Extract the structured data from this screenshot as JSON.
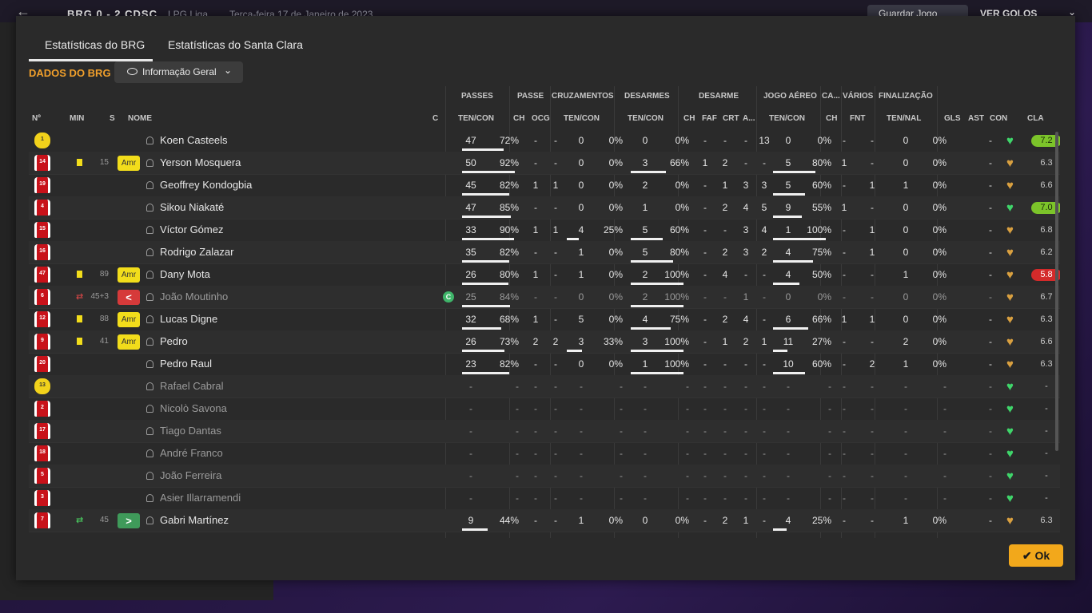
{
  "topbar": {
    "score": "BRG 0 - 2 CDSC",
    "league": "LPG Liga",
    "date": "Terça-feira 17 de Janeiro de 2023",
    "save_label": "Guardar Jogo",
    "goals_label": "VER GOLOS"
  },
  "tabs": [
    "Estatísticas do BRG",
    "Estatísticas do Santa Clara"
  ],
  "section_title": "DADOS DO BRG",
  "view_select": "Informação Geral",
  "ok_label": "Ok",
  "groups": {
    "passes": "PASSES",
    "passe": "PASSE",
    "cruz": "CRUZAMENTOS",
    "desarmes": "DESARMES",
    "desarme": "DESARME",
    "aereo": "JOGO AÉREO",
    "ca": "CA...",
    "varios": "VÁRIOS",
    "final": "FINALIZAÇÃO"
  },
  "columns": {
    "num": "Nº",
    "min": "MIN",
    "s": "S",
    "nome": "NOME",
    "c": "C",
    "pass_tc": "TEN/CON",
    "pch": "CH",
    "pocg": "OCG",
    "cruz_tc": "TEN/CON",
    "des_tc": "TEN/CON",
    "dch": "CH",
    "dfaf": "FAF",
    "dcrt": "CRT",
    "da": "A...",
    "aer_tc": "TEN/CON",
    "cach": "CH",
    "vfnt": "FNT",
    "fin_tn": "TEN/NAL",
    "gls": "GLS",
    "ast": "AST",
    "con": "CON",
    "cla": "CLA"
  },
  "players": [
    {
      "num": "1",
      "kit": "yellow",
      "min": "",
      "card": false,
      "sub": "",
      "role": "",
      "name": "Koen Casteels",
      "c": false,
      "pt": "47",
      "pp": "72%",
      "pch": "-",
      "pocg": "-",
      "ct": "0",
      "cp": "0%",
      "dt": "0",
      "dp": "0%",
      "dch": "-",
      "dfaf": "-",
      "dcrt": "-",
      "da": "13",
      "at": "0",
      "ap": "0%",
      "cach": "-",
      "vfnt": "-",
      "ft": "0",
      "fp": "0%",
      "gls": "",
      "ast": "-",
      "rating": "7.2",
      "rstyle": "green",
      "pbar": 0.72,
      "cbar": 0,
      "dbar": 0,
      "abar": 0
    },
    {
      "num": "14",
      "kit": "red",
      "min": "15",
      "card": true,
      "sub": "",
      "role": "Amr",
      "name": "Yerson Mosquera",
      "c": false,
      "pt": "50",
      "pp": "92%",
      "pch": "-",
      "pocg": "-",
      "ct": "0",
      "cp": "0%",
      "dt": "3",
      "dp": "66%",
      "dch": "1",
      "dfaf": "2",
      "dcrt": "-",
      "da": "-",
      "at": "5",
      "ap": "80%",
      "cach": "1",
      "vfnt": "-",
      "ft": "0",
      "fp": "0%",
      "gls": "",
      "ast": "-",
      "rating": "6.3",
      "rstyle": "plain",
      "pbar": 0.92,
      "cbar": 0,
      "dbar": 0.66,
      "abar": 0.8
    },
    {
      "num": "19",
      "kit": "red",
      "min": "",
      "card": false,
      "sub": "",
      "role": "",
      "name": "Geoffrey Kondogbia",
      "c": false,
      "pt": "45",
      "pp": "82%",
      "pch": "1",
      "pocg": "1",
      "ct": "0",
      "cp": "0%",
      "dt": "2",
      "dp": "0%",
      "dch": "-",
      "dfaf": "1",
      "dcrt": "3",
      "da": "3",
      "at": "5",
      "ap": "60%",
      "cach": "-",
      "vfnt": "1",
      "ft": "1",
      "fp": "0%",
      "gls": "",
      "ast": "-",
      "rating": "6.6",
      "rstyle": "plain",
      "pbar": 0.82,
      "cbar": 0,
      "dbar": 0,
      "abar": 0.6
    },
    {
      "num": "4",
      "kit": "red",
      "min": "",
      "card": false,
      "sub": "",
      "role": "",
      "name": "Sikou Niakaté",
      "c": false,
      "pt": "47",
      "pp": "85%",
      "pch": "-",
      "pocg": "-",
      "ct": "0",
      "cp": "0%",
      "dt": "1",
      "dp": "0%",
      "dch": "-",
      "dfaf": "2",
      "dcrt": "4",
      "da": "5",
      "at": "9",
      "ap": "55%",
      "cach": "1",
      "vfnt": "-",
      "ft": "0",
      "fp": "0%",
      "gls": "",
      "ast": "-",
      "rating": "7.0",
      "rstyle": "green",
      "pbar": 0.85,
      "cbar": 0,
      "dbar": 0,
      "abar": 0.55
    },
    {
      "num": "15",
      "kit": "red",
      "min": "",
      "card": false,
      "sub": "",
      "role": "",
      "name": "Víctor Gómez",
      "c": false,
      "pt": "33",
      "pp": "90%",
      "pch": "1",
      "pocg": "1",
      "ct": "4",
      "cp": "25%",
      "dt": "5",
      "dp": "60%",
      "dch": "-",
      "dfaf": "-",
      "dcrt": "3",
      "da": "4",
      "at": "1",
      "ap": "100%",
      "cach": "-",
      "vfnt": "1",
      "ft": "0",
      "fp": "0%",
      "gls": "",
      "ast": "-",
      "rating": "6.8",
      "rstyle": "plain",
      "pbar": 0.9,
      "cbar": 0.25,
      "dbar": 0.6,
      "abar": 1.0
    },
    {
      "num": "16",
      "kit": "red",
      "min": "",
      "card": false,
      "sub": "",
      "role": "",
      "name": "Rodrigo Zalazar",
      "c": false,
      "pt": "35",
      "pp": "82%",
      "pch": "-",
      "pocg": "-",
      "ct": "1",
      "cp": "0%",
      "dt": "5",
      "dp": "80%",
      "dch": "-",
      "dfaf": "2",
      "dcrt": "3",
      "da": "2",
      "at": "4",
      "ap": "75%",
      "cach": "-",
      "vfnt": "1",
      "ft": "0",
      "fp": "0%",
      "gls": "",
      "ast": "-",
      "rating": "6.2",
      "rstyle": "plain",
      "pbar": 0.82,
      "cbar": 0,
      "dbar": 0.8,
      "abar": 0.75
    },
    {
      "num": "47",
      "kit": "red",
      "min": "89",
      "card": true,
      "sub": "",
      "role": "Amr",
      "name": "Dany Mota",
      "c": false,
      "pt": "26",
      "pp": "80%",
      "pch": "1",
      "pocg": "-",
      "ct": "1",
      "cp": "0%",
      "dt": "2",
      "dp": "100%",
      "dch": "-",
      "dfaf": "4",
      "dcrt": "-",
      "da": "-",
      "at": "4",
      "ap": "50%",
      "cach": "-",
      "vfnt": "-",
      "ft": "1",
      "fp": "0%",
      "gls": "",
      "ast": "-",
      "rating": "5.8",
      "rstyle": "red",
      "pbar": 0.8,
      "cbar": 0,
      "dbar": 1.0,
      "abar": 0.5
    },
    {
      "num": "6",
      "kit": "red",
      "min": "45+3",
      "card": false,
      "sub": "out",
      "role": "out",
      "name": "João Moutinho",
      "c": true,
      "pt": "25",
      "pp": "84%",
      "pch": "-",
      "pocg": "-",
      "ct": "0",
      "cp": "0%",
      "dt": "2",
      "dp": "100%",
      "dch": "-",
      "dfaf": "-",
      "dcrt": "1",
      "da": "-",
      "at": "0",
      "ap": "0%",
      "cach": "-",
      "vfnt": "-",
      "ft": "0",
      "fp": "0%",
      "gls": "",
      "ast": "-",
      "rating": "6.7",
      "rstyle": "plain",
      "pbar": 0.84,
      "cbar": 0,
      "dbar": 1.0,
      "abar": 0,
      "dim": true
    },
    {
      "num": "12",
      "kit": "red",
      "min": "88",
      "card": true,
      "sub": "",
      "role": "Amr",
      "name": "Lucas Digne",
      "c": false,
      "pt": "32",
      "pp": "68%",
      "pch": "1",
      "pocg": "-",
      "ct": "5",
      "cp": "0%",
      "dt": "4",
      "dp": "75%",
      "dch": "-",
      "dfaf": "2",
      "dcrt": "4",
      "da": "-",
      "at": "6",
      "ap": "66%",
      "cach": "1",
      "vfnt": "1",
      "ft": "0",
      "fp": "0%",
      "gls": "",
      "ast": "-",
      "rating": "6.3",
      "rstyle": "plain",
      "pbar": 0.68,
      "cbar": 0,
      "dbar": 0.75,
      "abar": 0.66
    },
    {
      "num": "9",
      "kit": "red",
      "min": "41",
      "card": true,
      "sub": "",
      "role": "Amr",
      "name": "Pedro",
      "c": false,
      "pt": "26",
      "pp": "73%",
      "pch": "2",
      "pocg": "2",
      "ct": "3",
      "cp": "33%",
      "dt": "3",
      "dp": "100%",
      "dch": "-",
      "dfaf": "1",
      "dcrt": "2",
      "da": "1",
      "at": "11",
      "ap": "27%",
      "cach": "-",
      "vfnt": "-",
      "ft": "2",
      "fp": "0%",
      "gls": "",
      "ast": "-",
      "rating": "6.6",
      "rstyle": "plain",
      "pbar": 0.73,
      "cbar": 0.33,
      "dbar": 1.0,
      "abar": 0.27
    },
    {
      "num": "20",
      "kit": "red",
      "min": "",
      "card": false,
      "sub": "",
      "role": "",
      "name": "Pedro Raul",
      "c": false,
      "pt": "23",
      "pp": "82%",
      "pch": "-",
      "pocg": "-",
      "ct": "0",
      "cp": "0%",
      "dt": "1",
      "dp": "100%",
      "dch": "-",
      "dfaf": "-",
      "dcrt": "-",
      "da": "-",
      "at": "10",
      "ap": "60%",
      "cach": "-",
      "vfnt": "2",
      "ft": "1",
      "fp": "0%",
      "gls": "",
      "ast": "-",
      "rating": "6.3",
      "rstyle": "plain",
      "pbar": 0.82,
      "cbar": 0,
      "dbar": 1.0,
      "abar": 0.6
    },
    {
      "num": "13",
      "kit": "yellow",
      "min": "",
      "card": false,
      "sub": "",
      "role": "",
      "name": "Rafael Cabral",
      "c": false,
      "pt": "-",
      "pp": "-",
      "pch": "-",
      "pocg": "-",
      "ct": "-",
      "cp": "-",
      "dt": "-",
      "dp": "-",
      "dch": "-",
      "dfaf": "-",
      "dcrt": "-",
      "da": "-",
      "at": "-",
      "ap": "-",
      "cach": "-",
      "vfnt": "-",
      "ft": "-",
      "fp": "-",
      "gls": "",
      "ast": "-",
      "rating": "-",
      "rstyle": "plain",
      "pbar": 0,
      "cbar": 0,
      "dbar": 0,
      "abar": 0,
      "dim": true
    },
    {
      "num": "2",
      "kit": "red",
      "min": "",
      "card": false,
      "sub": "",
      "role": "",
      "name": "Nicolò Savona",
      "c": false,
      "pt": "-",
      "pp": "-",
      "pch": "-",
      "pocg": "-",
      "ct": "-",
      "cp": "-",
      "dt": "-",
      "dp": "-",
      "dch": "-",
      "dfaf": "-",
      "dcrt": "-",
      "da": "-",
      "at": "-",
      "ap": "-",
      "cach": "-",
      "vfnt": "-",
      "ft": "-",
      "fp": "-",
      "gls": "",
      "ast": "-",
      "rating": "-",
      "rstyle": "plain",
      "pbar": 0,
      "cbar": 0,
      "dbar": 0,
      "abar": 0,
      "dim": true
    },
    {
      "num": "17",
      "kit": "red",
      "min": "",
      "card": false,
      "sub": "",
      "role": "",
      "name": "Tiago Dantas",
      "c": false,
      "pt": "-",
      "pp": "-",
      "pch": "-",
      "pocg": "-",
      "ct": "-",
      "cp": "-",
      "dt": "-",
      "dp": "-",
      "dch": "-",
      "dfaf": "-",
      "dcrt": "-",
      "da": "-",
      "at": "-",
      "ap": "-",
      "cach": "-",
      "vfnt": "-",
      "ft": "-",
      "fp": "-",
      "gls": "",
      "ast": "-",
      "rating": "-",
      "rstyle": "plain",
      "pbar": 0,
      "cbar": 0,
      "dbar": 0,
      "abar": 0,
      "dim": true
    },
    {
      "num": "18",
      "kit": "red",
      "min": "",
      "card": false,
      "sub": "",
      "role": "",
      "name": "André Franco",
      "c": false,
      "pt": "-",
      "pp": "-",
      "pch": "-",
      "pocg": "-",
      "ct": "-",
      "cp": "-",
      "dt": "-",
      "dp": "-",
      "dch": "-",
      "dfaf": "-",
      "dcrt": "-",
      "da": "-",
      "at": "-",
      "ap": "-",
      "cach": "-",
      "vfnt": "-",
      "ft": "-",
      "fp": "-",
      "gls": "",
      "ast": "-",
      "rating": "-",
      "rstyle": "plain",
      "pbar": 0,
      "cbar": 0,
      "dbar": 0,
      "abar": 0,
      "dim": true
    },
    {
      "num": "5",
      "kit": "red",
      "min": "",
      "card": false,
      "sub": "",
      "role": "",
      "name": "João Ferreira",
      "c": false,
      "pt": "-",
      "pp": "-",
      "pch": "-",
      "pocg": "-",
      "ct": "-",
      "cp": "-",
      "dt": "-",
      "dp": "-",
      "dch": "-",
      "dfaf": "-",
      "dcrt": "-",
      "da": "-",
      "at": "-",
      "ap": "-",
      "cach": "-",
      "vfnt": "-",
      "ft": "-",
      "fp": "-",
      "gls": "",
      "ast": "-",
      "rating": "-",
      "rstyle": "plain",
      "pbar": 0,
      "cbar": 0,
      "dbar": 0,
      "abar": 0,
      "dim": true
    },
    {
      "num": "3",
      "kit": "red",
      "min": "",
      "card": false,
      "sub": "",
      "role": "",
      "name": "Asier Illarramendi",
      "c": false,
      "pt": "-",
      "pp": "-",
      "pch": "-",
      "pocg": "-",
      "ct": "-",
      "cp": "-",
      "dt": "-",
      "dp": "-",
      "dch": "-",
      "dfaf": "-",
      "dcrt": "-",
      "da": "-",
      "at": "-",
      "ap": "-",
      "cach": "-",
      "vfnt": "-",
      "ft": "-",
      "fp": "-",
      "gls": "",
      "ast": "-",
      "rating": "-",
      "rstyle": "plain",
      "pbar": 0,
      "cbar": 0,
      "dbar": 0,
      "abar": 0,
      "dim": true
    },
    {
      "num": "7",
      "kit": "red",
      "min": "45",
      "card": false,
      "sub": "in",
      "role": "in",
      "name": "Gabri Martínez",
      "c": false,
      "pt": "9",
      "pp": "44%",
      "pch": "-",
      "pocg": "-",
      "ct": "1",
      "cp": "0%",
      "dt": "0",
      "dp": "0%",
      "dch": "-",
      "dfaf": "2",
      "dcrt": "1",
      "da": "-",
      "at": "4",
      "ap": "25%",
      "cach": "-",
      "vfnt": "-",
      "ft": "1",
      "fp": "0%",
      "gls": "",
      "ast": "-",
      "rating": "6.3",
      "rstyle": "plain",
      "pbar": 0.44,
      "cbar": 0,
      "dbar": 0,
      "abar": 0.25
    }
  ],
  "colors": {
    "accent": "#f2a02b",
    "ok": "#f2a81b",
    "rating_green": "#7cc42a",
    "rating_red": "#d42a2a"
  }
}
